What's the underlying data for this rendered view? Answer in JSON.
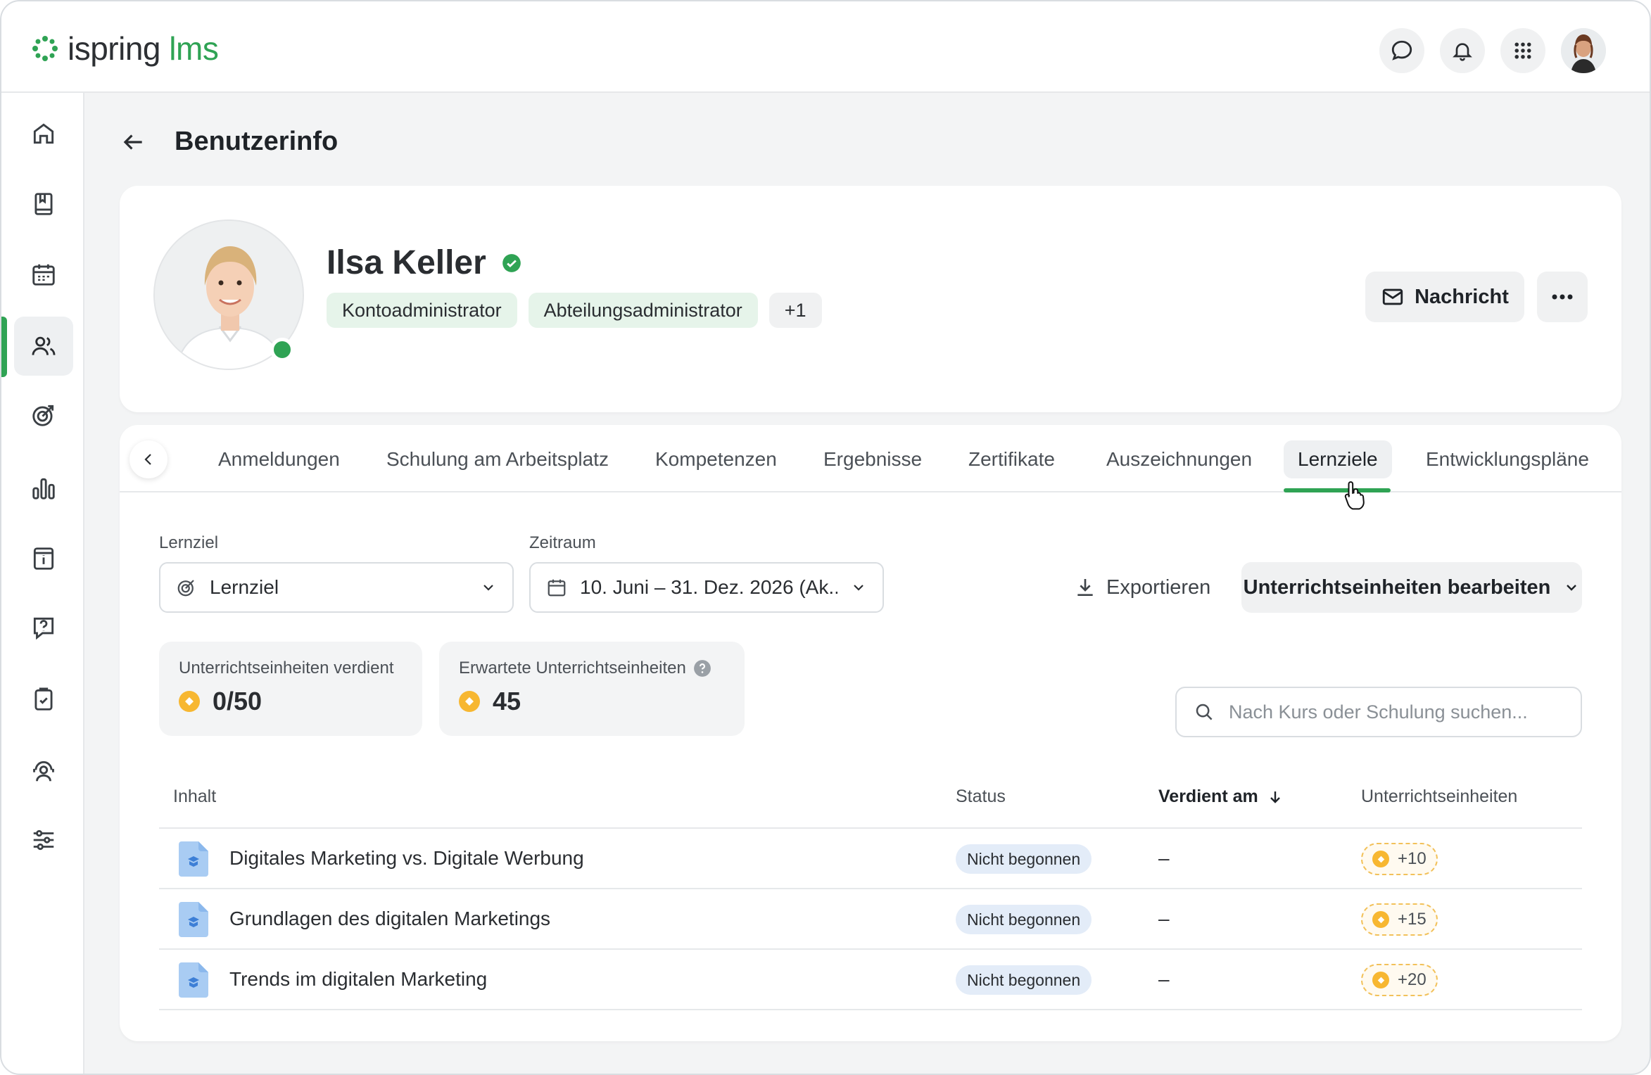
{
  "app": {
    "logo_main": "ispring",
    "logo_accent": "lms"
  },
  "colors": {
    "brand_green": "#2fa354",
    "coin": "#f7b731",
    "status_bg": "#e3ecf8"
  },
  "header_icons": [
    "chat-icon",
    "bell-icon",
    "apps-grid-icon",
    "user-avatar"
  ],
  "sidebar": {
    "items": [
      {
        "name": "home-icon"
      },
      {
        "name": "book-icon"
      },
      {
        "name": "calendar-icon"
      },
      {
        "name": "users-icon",
        "active": true
      },
      {
        "name": "target-icon"
      },
      {
        "name": "reports-icon"
      },
      {
        "name": "info-board-icon"
      },
      {
        "name": "help-question-icon"
      },
      {
        "name": "clipboard-check-icon"
      },
      {
        "name": "support-agent-icon"
      },
      {
        "name": "settings-sliders-icon"
      }
    ]
  },
  "page": {
    "title": "Benutzerinfo"
  },
  "profile": {
    "name": "Ilsa Keller",
    "roles": [
      "Kontoadministrator",
      "Abteilungsadministrator"
    ],
    "more_roles": "+1",
    "message_button": "Nachricht"
  },
  "tabs": {
    "items": [
      {
        "label": "Anmeldungen"
      },
      {
        "label": "Schulung am Arbeitsplatz"
      },
      {
        "label": "Kompetenzen"
      },
      {
        "label": "Ergebnisse"
      },
      {
        "label": "Zertifikate"
      },
      {
        "label": "Auszeichnungen"
      },
      {
        "label": "Lernziele",
        "active": true
      },
      {
        "label": "Entwicklungspläne"
      }
    ]
  },
  "filters": {
    "goal_label": "Lernziel",
    "goal_value": "Lernziel",
    "period_label": "Zeitraum",
    "period_value": "10. Juni – 31. Dez. 2026 (Ak...",
    "export": "Exportieren",
    "edit_units": "Unterrichtseinheiten bearbeiten"
  },
  "stats": {
    "earned_label": "Unterrichtseinheiten verdient",
    "earned_value": "0/50",
    "expected_label": "Erwartete Unterrichtseinheiten",
    "expected_value": "45"
  },
  "search": {
    "placeholder": "Nach Kurs oder Schulung suchen..."
  },
  "table": {
    "headers": {
      "content": "Inhalt",
      "status": "Status",
      "earned_on": "Verdient am",
      "units": "Unterrichtseinheiten"
    },
    "rows": [
      {
        "title": "Digitales Marketing vs. Digitale Werbung",
        "status": "Nicht begonnen",
        "earned_on": "–",
        "units": "+10"
      },
      {
        "title": "Grundlagen des digitalen Marketings",
        "status": "Nicht begonnen",
        "earned_on": "–",
        "units": "+15"
      },
      {
        "title": "Trends im digitalen Marketing",
        "status": "Nicht begonnen",
        "earned_on": "–",
        "units": "+20"
      }
    ]
  }
}
